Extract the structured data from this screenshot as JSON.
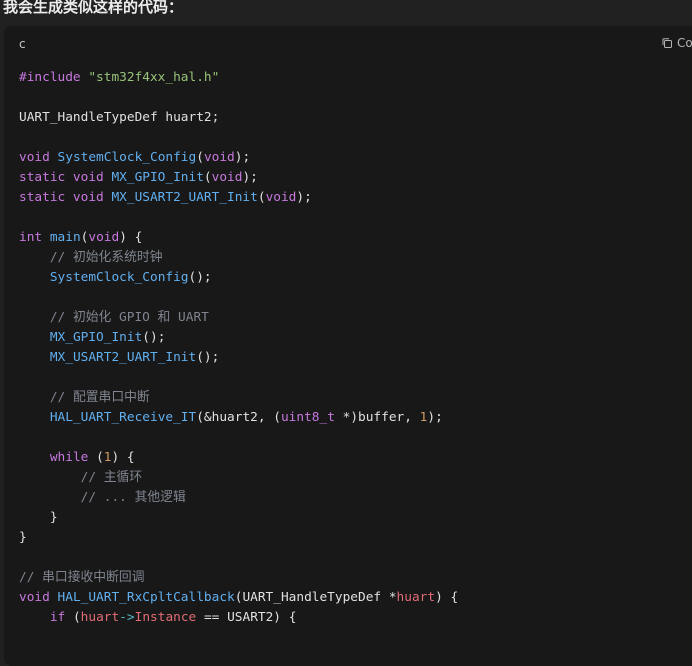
{
  "heading": "我会生成类似这样的代码：",
  "code_block": {
    "language": "c",
    "copy_label": "Co",
    "lines": [
      [
        {
          "t": "#include ",
          "c": "kw"
        },
        {
          "t": "\"stm32f4xx_hal.h\"",
          "c": "str"
        }
      ],
      [],
      [
        {
          "t": "UART_HandleTypeDef huart2;",
          "c": "plain"
        }
      ],
      [],
      [
        {
          "t": "void ",
          "c": "kw"
        },
        {
          "t": "SystemClock_Config",
          "c": "fn"
        },
        {
          "t": "(",
          "c": "plain"
        },
        {
          "t": "void",
          "c": "kw"
        },
        {
          "t": ");",
          "c": "plain"
        }
      ],
      [
        {
          "t": "static void ",
          "c": "kw"
        },
        {
          "t": "MX_GPIO_Init",
          "c": "fn"
        },
        {
          "t": "(",
          "c": "plain"
        },
        {
          "t": "void",
          "c": "kw"
        },
        {
          "t": ");",
          "c": "plain"
        }
      ],
      [
        {
          "t": "static void ",
          "c": "kw"
        },
        {
          "t": "MX_USART2_UART_Init",
          "c": "fn"
        },
        {
          "t": "(",
          "c": "plain"
        },
        {
          "t": "void",
          "c": "kw"
        },
        {
          "t": ");",
          "c": "plain"
        }
      ],
      [],
      [
        {
          "t": "int ",
          "c": "kw"
        },
        {
          "t": "main",
          "c": "fn"
        },
        {
          "t": "(",
          "c": "plain"
        },
        {
          "t": "void",
          "c": "kw"
        },
        {
          "t": ") {",
          "c": "plain"
        }
      ],
      [
        {
          "t": "    ",
          "c": "plain"
        },
        {
          "t": "// 初始化系统时钟",
          "c": "cmt"
        }
      ],
      [
        {
          "t": "    ",
          "c": "plain"
        },
        {
          "t": "SystemClock_Config",
          "c": "fn"
        },
        {
          "t": "();",
          "c": "plain"
        }
      ],
      [],
      [
        {
          "t": "    ",
          "c": "plain"
        },
        {
          "t": "// 初始化 GPIO 和 UART",
          "c": "cmt"
        }
      ],
      [
        {
          "t": "    ",
          "c": "plain"
        },
        {
          "t": "MX_GPIO_Init",
          "c": "fn"
        },
        {
          "t": "();",
          "c": "plain"
        }
      ],
      [
        {
          "t": "    ",
          "c": "plain"
        },
        {
          "t": "MX_USART2_UART_Init",
          "c": "fn"
        },
        {
          "t": "();",
          "c": "plain"
        }
      ],
      [],
      [
        {
          "t": "    ",
          "c": "plain"
        },
        {
          "t": "// 配置串口中断",
          "c": "cmt"
        }
      ],
      [
        {
          "t": "    ",
          "c": "plain"
        },
        {
          "t": "HAL_UART_Receive_IT",
          "c": "fn"
        },
        {
          "t": "(&huart2, (",
          "c": "plain"
        },
        {
          "t": "uint8_t",
          "c": "typ"
        },
        {
          "t": " *)buffer, ",
          "c": "plain"
        },
        {
          "t": "1",
          "c": "num"
        },
        {
          "t": ");",
          "c": "plain"
        }
      ],
      [],
      [
        {
          "t": "    ",
          "c": "plain"
        },
        {
          "t": "while",
          "c": "kw"
        },
        {
          "t": " (",
          "c": "plain"
        },
        {
          "t": "1",
          "c": "num"
        },
        {
          "t": ") {",
          "c": "plain"
        }
      ],
      [
        {
          "t": "        ",
          "c": "plain"
        },
        {
          "t": "// 主循环",
          "c": "cmt"
        }
      ],
      [
        {
          "t": "        ",
          "c": "plain"
        },
        {
          "t": "// ... 其他逻辑",
          "c": "cmt"
        }
      ],
      [
        {
          "t": "    }",
          "c": "plain"
        }
      ],
      [
        {
          "t": "}",
          "c": "plain"
        }
      ],
      [],
      [
        {
          "t": "// 串口接收中断回调",
          "c": "cmt"
        }
      ],
      [
        {
          "t": "void ",
          "c": "kw"
        },
        {
          "t": "HAL_UART_RxCpltCallback",
          "c": "fn"
        },
        {
          "t": "(UART_HandleTypeDef *",
          "c": "plain"
        },
        {
          "t": "huart",
          "c": "var"
        },
        {
          "t": ") {",
          "c": "plain"
        }
      ],
      [
        {
          "t": "    ",
          "c": "plain"
        },
        {
          "t": "if",
          "c": "kw"
        },
        {
          "t": " (",
          "c": "plain"
        },
        {
          "t": "huart",
          "c": "var"
        },
        {
          "t": "->",
          "c": "op"
        },
        {
          "t": "Instance",
          "c": "var"
        },
        {
          "t": " == USART2) {",
          "c": "plain"
        }
      ]
    ]
  },
  "colors": {
    "background": "#212121",
    "code_background": "#181818",
    "keyword": "#c678dd",
    "function": "#61afef",
    "string": "#98c379",
    "comment": "#7f848e",
    "number": "#d19a66",
    "variable": "#e06c75"
  },
  "icons": {
    "copy": "copy-icon"
  }
}
